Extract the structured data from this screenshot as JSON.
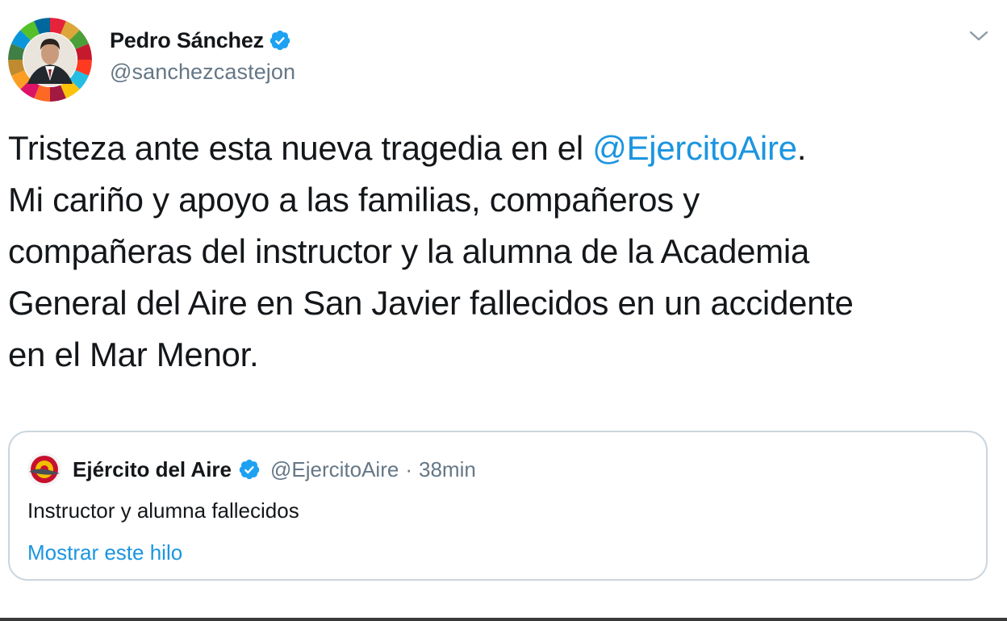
{
  "author": {
    "display_name": "Pedro Sánchez",
    "handle": "@sanchezcastejon",
    "verified": true
  },
  "tweet": {
    "text_before_mention": "Tristeza ante esta nueva tragedia en el ",
    "mention": "@EjercitoAire",
    "text_after_mention": ".\nMi cariño y apoyo a las familias, compañeros y\ncompañeras del instructor y la alumna de la Academia\nGeneral del Aire en San Javier fallecidos en un accidente\nen el Mar Menor."
  },
  "quoted_tweet": {
    "display_name": "Ejército del Aire",
    "handle": "@EjercitoAire",
    "separator": "·",
    "time": "38min",
    "text": "Instructor y alumna fallecidos",
    "show_thread_label": "Mostrar este hilo"
  },
  "icons": {
    "verified": "verified-badge-icon",
    "menu": "chevron-down-icon"
  },
  "colors": {
    "link": "#1b95e0",
    "verified": "#1da1f2",
    "secondary_text": "#657786",
    "border": "#ccd6dd"
  }
}
